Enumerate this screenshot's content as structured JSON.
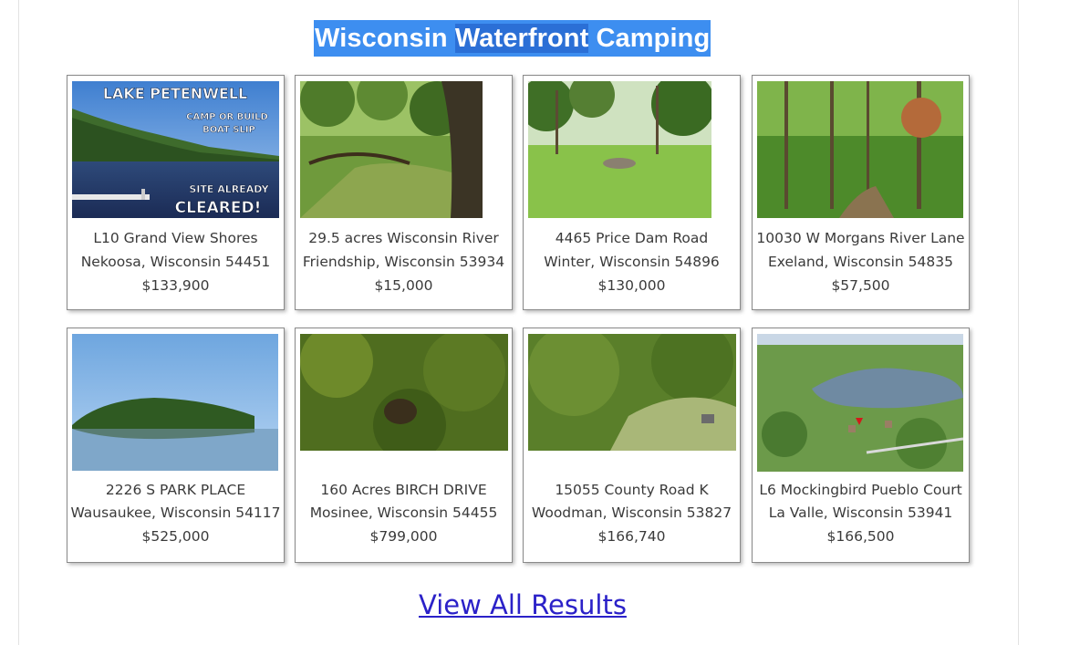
{
  "section": {
    "title_part1": "Wisconsin ",
    "title_part2": "Waterfront",
    "title_part3": " Camping"
  },
  "listings": [
    {
      "address": "L10 Grand View Shores",
      "city_state_zip": "Nekoosa, Wisconsin 54451",
      "price": "$133,900",
      "photo_text": {
        "line1": "LAKE PETENWELL",
        "line2": "CAMP OR BUILD",
        "line3": "BOAT SLIP",
        "line4": "SITE ALREADY",
        "line5": "CLEARED!"
      }
    },
    {
      "address": "29.5 acres Wisconsin River",
      "city_state_zip": "Friendship, Wisconsin 53934",
      "price": "$15,000"
    },
    {
      "address": "4465 Price Dam Road",
      "city_state_zip": "Winter, Wisconsin 54896",
      "price": "$130,000"
    },
    {
      "address": "10030 W Morgans River Lane",
      "city_state_zip": "Exeland, Wisconsin 54835",
      "price": "$57,500"
    },
    {
      "address": "2226 S PARK PLACE",
      "city_state_zip": "Wausaukee, Wisconsin 54117",
      "price": "$525,000"
    },
    {
      "address": "160 Acres BIRCH DRIVE",
      "city_state_zip": "Mosinee, Wisconsin 54455",
      "price": "$799,000"
    },
    {
      "address": "15055 County Road K",
      "city_state_zip": "Woodman, Wisconsin 53827",
      "price": "$166,740"
    },
    {
      "address": "L6 Mockingbird Pueblo Court",
      "city_state_zip": "La Valle, Wisconsin 53941",
      "price": "$166,500"
    }
  ],
  "view_all_label": "View All Results",
  "colors": {
    "title_bg": "#3d8ef0",
    "title_highlight": "#2b6fd6",
    "link": "#2b21c8"
  }
}
